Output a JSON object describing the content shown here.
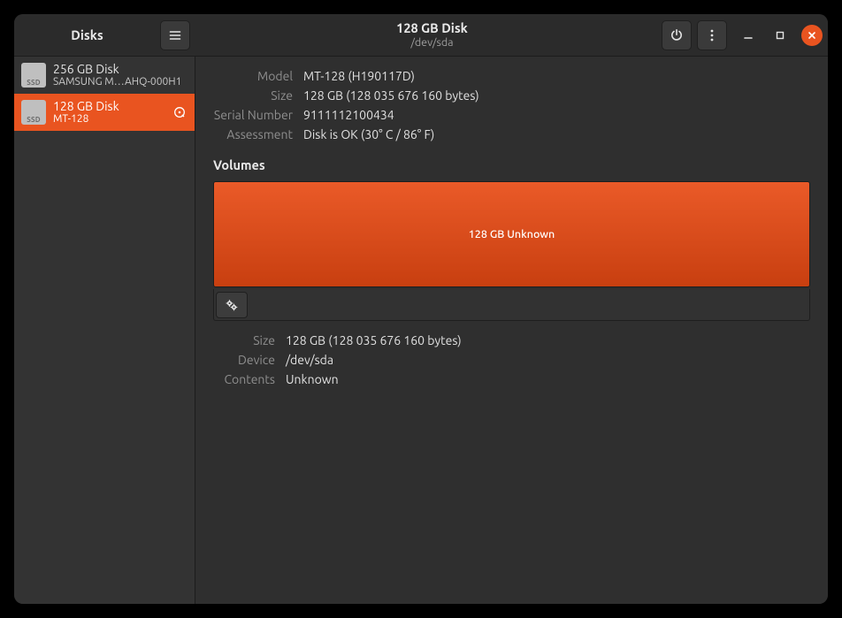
{
  "app_title": "Disks",
  "header": {
    "selected_title": "128 GB Disk",
    "selected_path": "/dev/sda"
  },
  "sidebar": {
    "items": [
      {
        "title": "256 GB Disk",
        "subtitle": "SAMSUNG M…AHQ-000H1",
        "icon_text": "SSD"
      },
      {
        "title": "128 GB Disk",
        "subtitle": "MT-128",
        "icon_text": "SSD"
      }
    ]
  },
  "details": {
    "model_label": "Model",
    "model_value": "MT-128 (H190117D)",
    "size_label": "Size",
    "size_value": "128 GB (128 035 676 160 bytes)",
    "serial_label": "Serial Number",
    "serial_value": "9111112100434",
    "assessment_label": "Assessment",
    "assessment_value": "Disk is OK (30° C / 86° F)"
  },
  "volumes": {
    "section_title": "Volumes",
    "segments": [
      {
        "label": "128 GB Unknown"
      }
    ],
    "props": {
      "size_label": "Size",
      "size_value": "128 GB (128 035 676 160 bytes)",
      "device_label": "Device",
      "device_value": "/dev/sda",
      "contents_label": "Contents",
      "contents_value": "Unknown"
    }
  }
}
